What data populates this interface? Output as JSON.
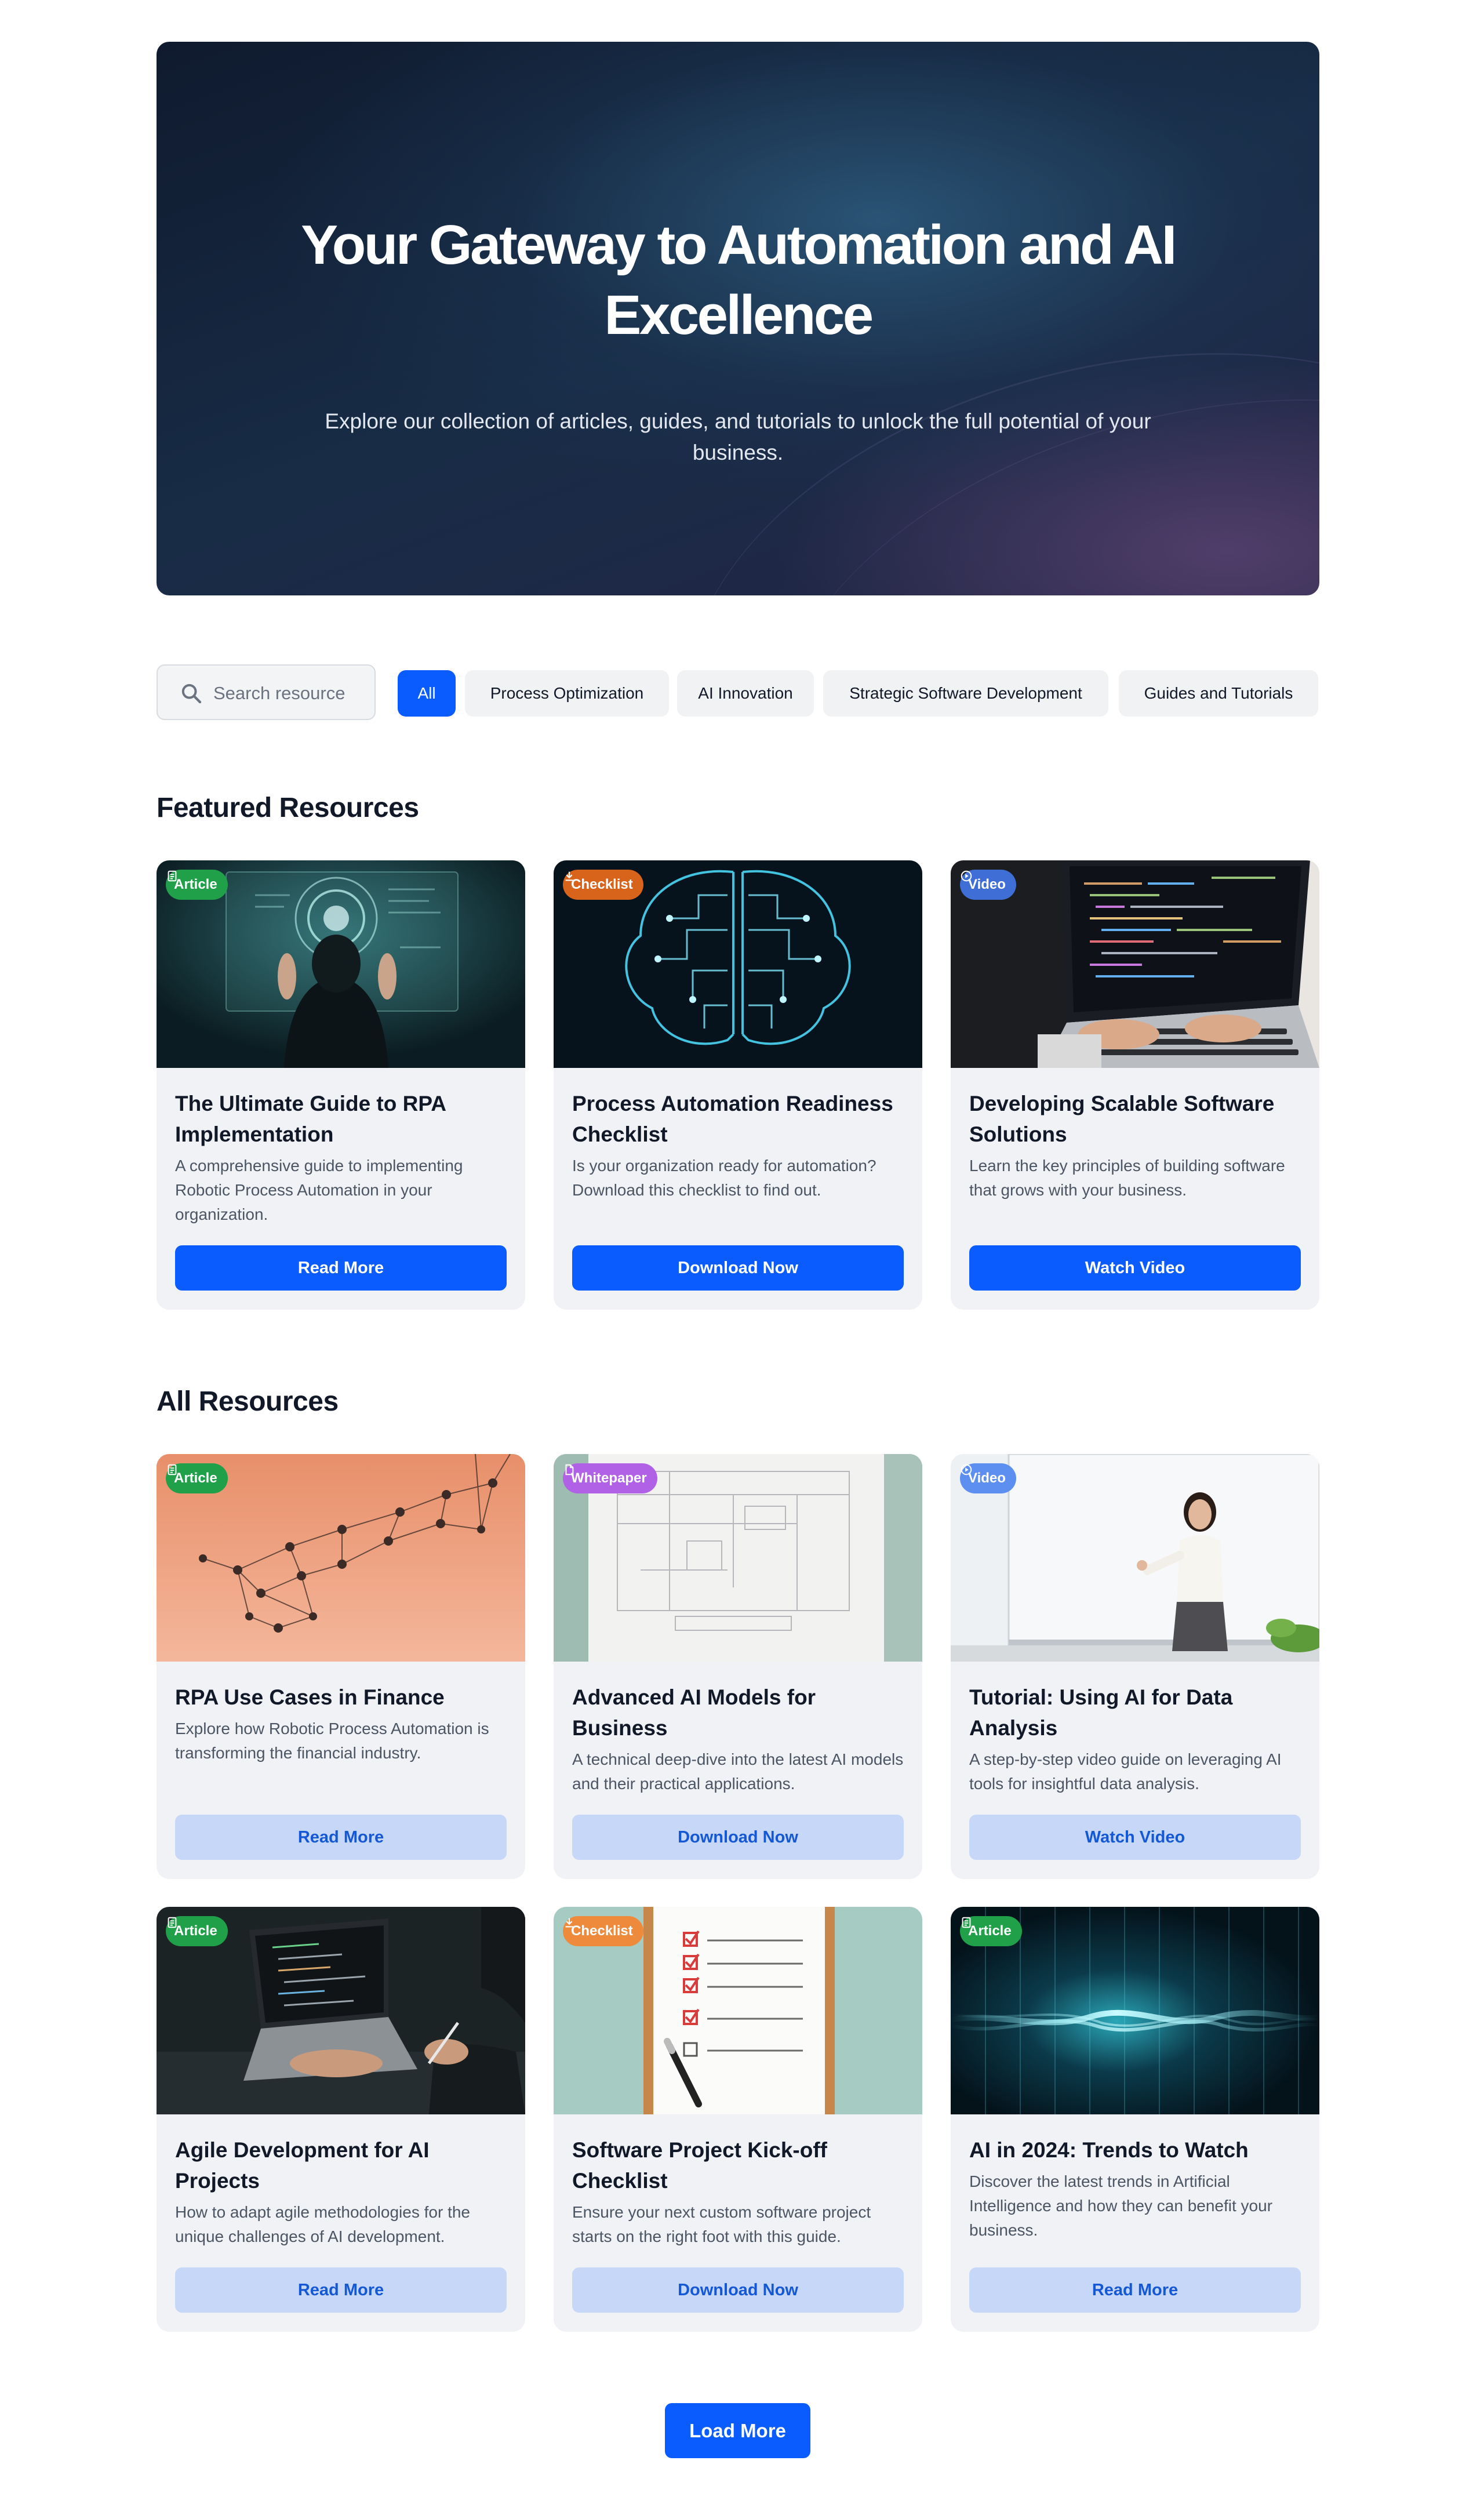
{
  "hero": {
    "title": "Your Gateway to Automation and AI Excellence",
    "subtitle": "Explore our collection of articles, guides, and tutorials to unlock the full potential of your business."
  },
  "search": {
    "placeholder": "Search resource",
    "value": ""
  },
  "filters": [
    {
      "label": "All",
      "active": true
    },
    {
      "label": "Process Optimization",
      "active": false
    },
    {
      "label": "AI Innovation",
      "active": false
    },
    {
      "label": "Strategic Software Development",
      "active": false
    },
    {
      "label": "Guides and Tutorials",
      "active": false
    }
  ],
  "featured": {
    "title": "Featured Resources",
    "cards": [
      {
        "badge": "Article",
        "badge_icon": "document-icon",
        "badge_color": "#21a04a",
        "image": "hologram-person",
        "title": "The Ultimate Guide to RPA Implementation",
        "description": "A comprehensive guide to implementing Robotic Process Automation in your organization.",
        "button": "Read More"
      },
      {
        "badge": "Checklist",
        "badge_icon": "download-icon",
        "badge_color": "#d8631b",
        "image": "circuit-brain",
        "title": "Process Automation Readiness Checklist",
        "description": "Is your organization ready for automation? Download this checklist to find out.",
        "button": "Download Now"
      },
      {
        "badge": "Video",
        "badge_icon": "play-icon",
        "badge_color": "#3f6fd6",
        "image": "laptop-code",
        "title": "Developing Scalable Software Solutions",
        "description": "Learn the key principles of building software that grows with your business.",
        "button": "Watch Video"
      }
    ]
  },
  "all": {
    "title": "All Resources",
    "cards": [
      {
        "badge": "Article",
        "badge_icon": "document-icon",
        "badge_color": "#21a04a",
        "image": "network-nodes",
        "title": "RPA Use Cases in Finance",
        "description": "Explore how Robotic Process Automation is transforming the financial industry.",
        "button": "Read More"
      },
      {
        "badge": "Whitepaper",
        "badge_icon": "file-icon",
        "badge_color": "#b061e6",
        "image": "blueprint",
        "title": "Advanced AI Models for Business",
        "description": "A technical deep-dive into the latest AI models and their practical applications.",
        "button": "Download Now"
      },
      {
        "badge": "Video",
        "badge_icon": "play-icon",
        "badge_color": "#5c8ff0",
        "image": "presenter",
        "title": "Tutorial: Using AI for Data Analysis",
        "description": "A step-by-step video guide on leveraging AI tools for insightful data analysis.",
        "button": "Watch Video"
      },
      {
        "badge": "Article",
        "badge_icon": "document-icon",
        "badge_color": "#21a04a",
        "image": "laptop-writing",
        "title": "Agile Development for AI Projects",
        "description": "How to adapt agile methodologies for the unique challenges of AI development.",
        "button": "Read More"
      },
      {
        "badge": "Checklist",
        "badge_icon": "download-icon",
        "badge_color": "#ee8a3c",
        "image": "clipboard-checklist",
        "title": "Software Project Kick-off Checklist",
        "description": "Ensure your next custom software project starts on the right foot with this guide.",
        "button": "Download Now"
      },
      {
        "badge": "Article",
        "badge_icon": "document-icon",
        "badge_color": "#21a04a",
        "image": "data-wave",
        "title": "AI in 2024: Trends to Watch",
        "description": "Discover the latest trends in Artificial Intelligence and how they can benefit your business.",
        "button": "Read More"
      }
    ]
  },
  "load_more": "Load More",
  "colors": {
    "primary": "#0b5cff",
    "soft_button": "#c6d7f8",
    "card_bg": "#f1f2f5"
  }
}
